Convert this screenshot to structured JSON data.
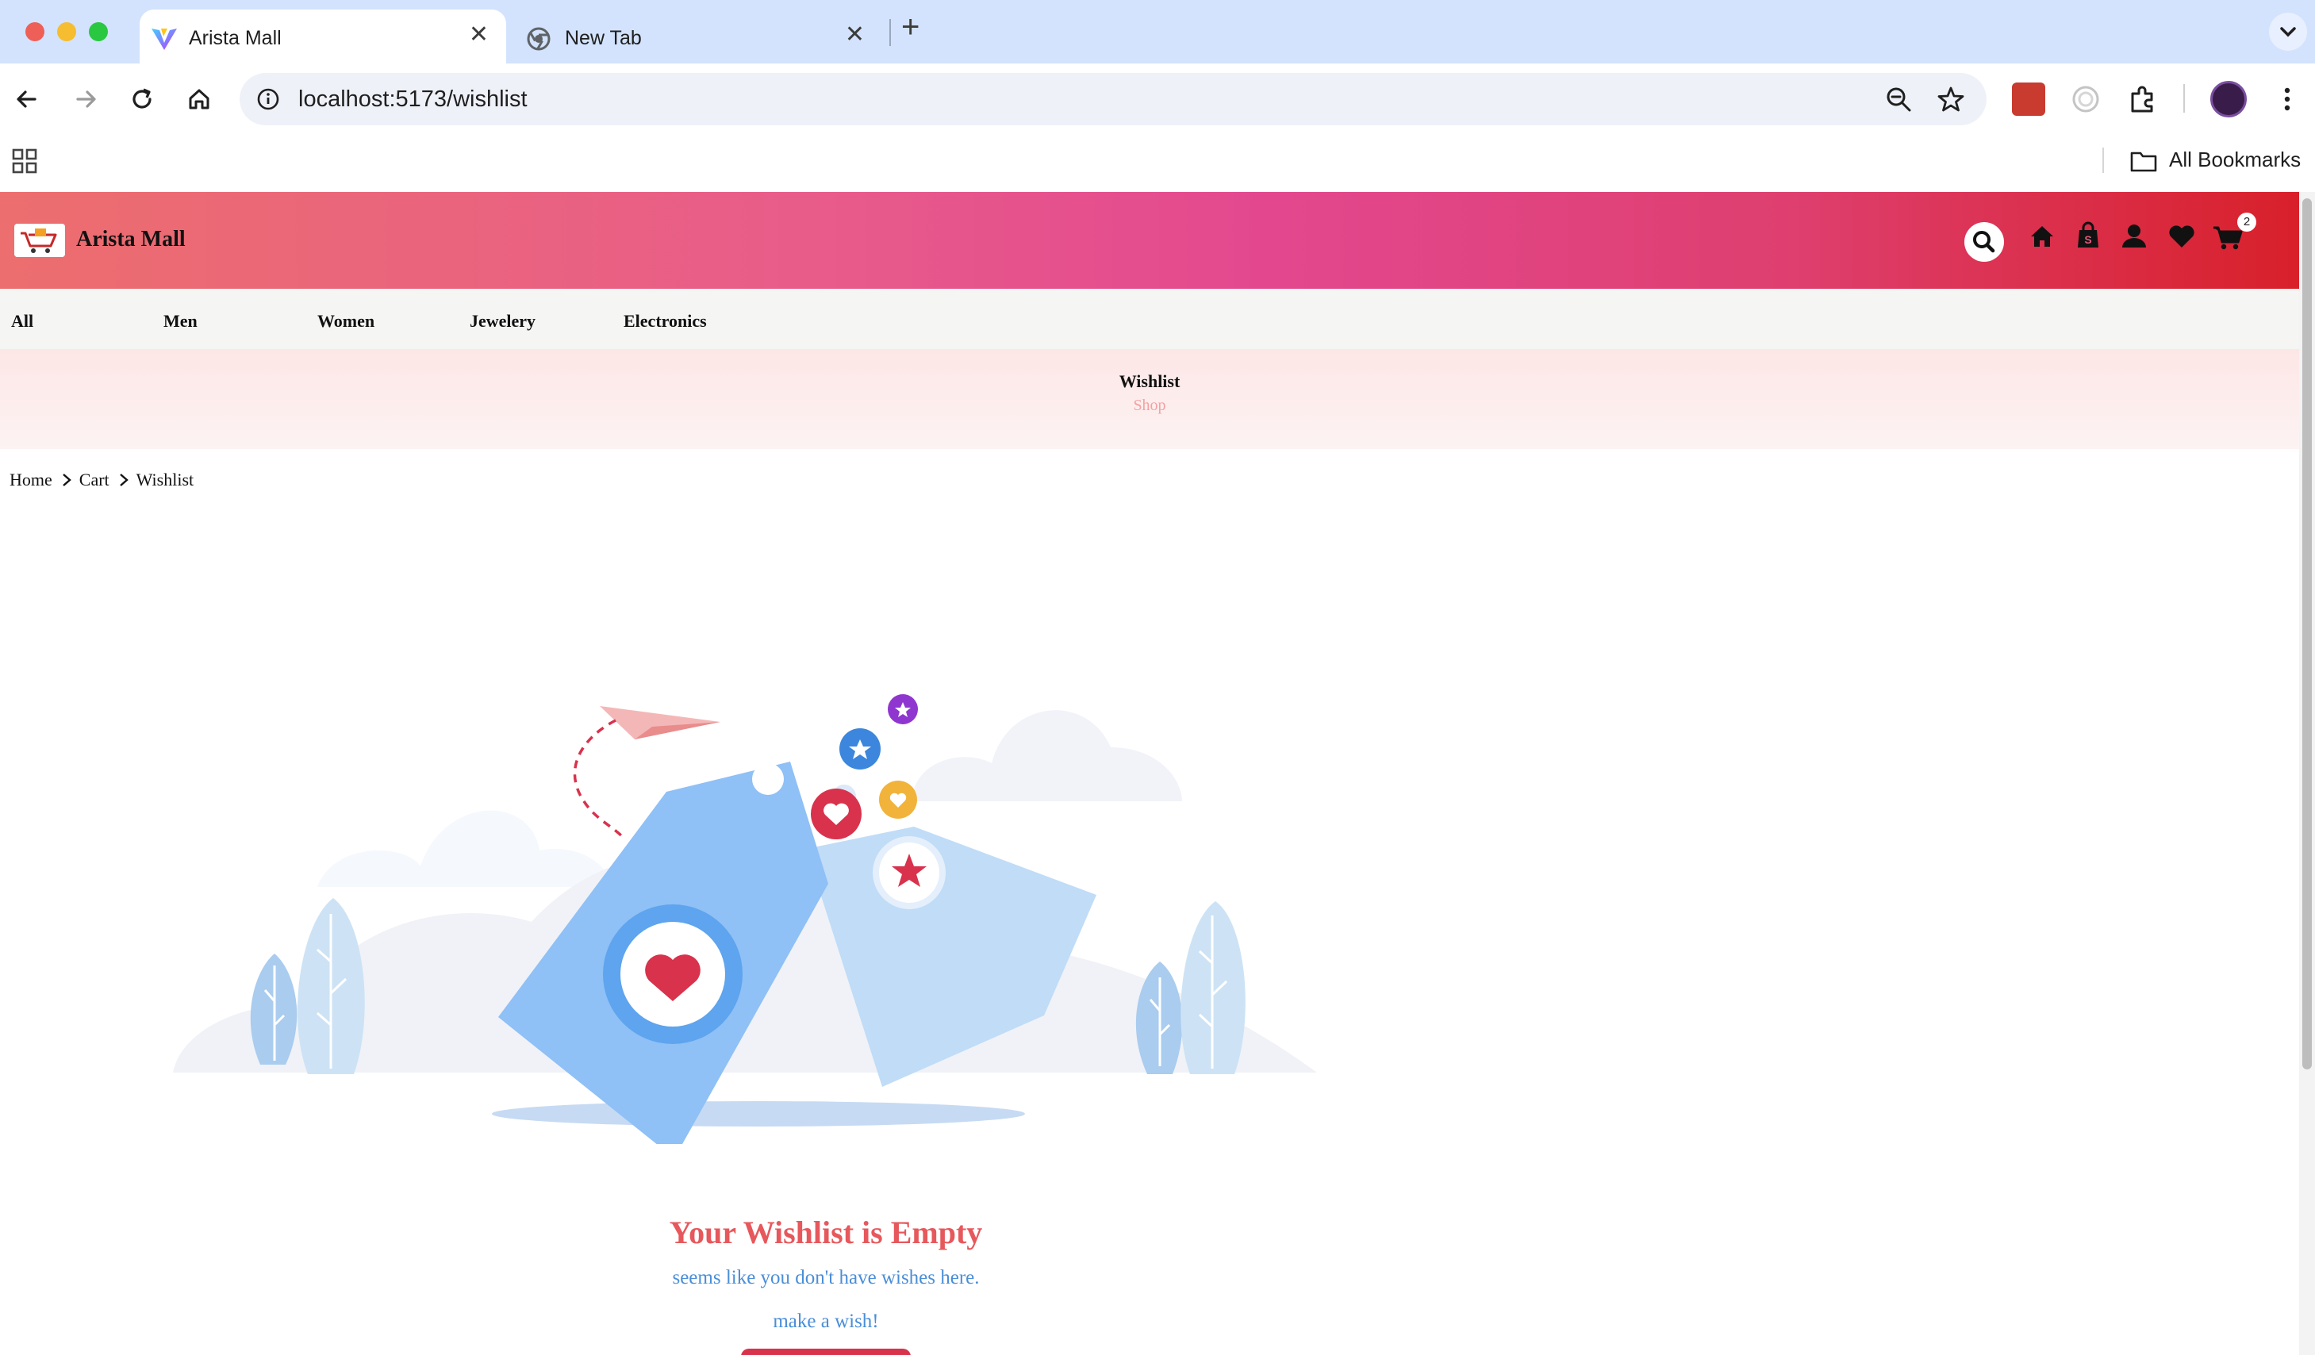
{
  "browser": {
    "tabs": [
      {
        "title": "Arista Mall",
        "active": true
      },
      {
        "title": "New Tab",
        "active": false
      }
    ],
    "url": "localhost:5173/wishlist",
    "bookmarks_label": "All Bookmarks",
    "colors": {
      "tabbar": "#d3e3fd",
      "omnibox": "#eef1f8"
    }
  },
  "site": {
    "name": "Arista Mall",
    "cart_count": "2",
    "header_colors": [
      "#ec6e6e",
      "#e3488f",
      "#d8202a"
    ],
    "header_icons": [
      "search-icon",
      "home-icon",
      "shop-bag-icon",
      "user-icon",
      "heart-icon",
      "cart-icon"
    ]
  },
  "nav": {
    "items": [
      "All",
      "Men",
      "Women",
      "Jewelery",
      "Electronics"
    ]
  },
  "banner": {
    "title": "Wishlist",
    "subtitle": "Shop"
  },
  "breadcrumb": {
    "items": [
      "Home",
      "Cart",
      "Wishlist"
    ]
  },
  "empty_state": {
    "title": "Your Wishlist is Empty",
    "subtitle": "seems like you don't have wishes here.",
    "cta": "make a wish!",
    "title_color": "#e6585c",
    "text_color": "#4a8ed8",
    "button_color": "#d8324c"
  }
}
